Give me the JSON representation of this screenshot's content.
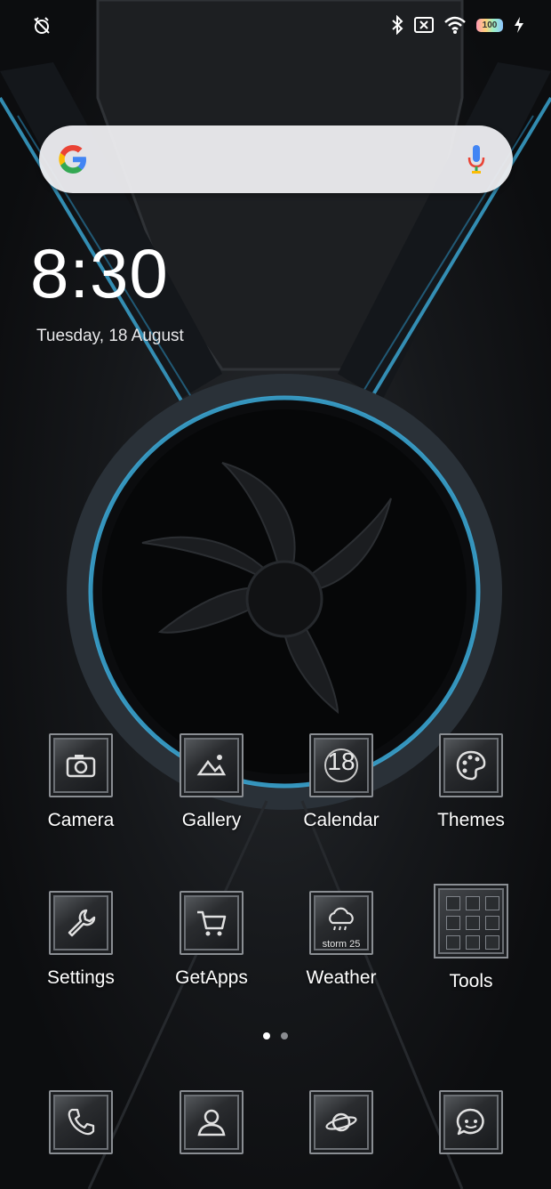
{
  "status_bar": {
    "left_icon": "alarm-off-icon",
    "right_icons": [
      "bluetooth-icon",
      "sim-off-icon",
      "wifi-icon",
      "battery-icon",
      "charging-icon"
    ],
    "battery_level": "100"
  },
  "search": {
    "logo": "G",
    "mic": "mic-icon"
  },
  "clock": {
    "time": "8:30",
    "date": "Tuesday, 18 August"
  },
  "apps_row1": [
    {
      "label": "Camera",
      "icon": "camera-icon"
    },
    {
      "label": "Gallery",
      "icon": "gallery-icon"
    },
    {
      "label": "Calendar",
      "icon": "calendar-icon",
      "icon_text": "18"
    },
    {
      "label": "Themes",
      "icon": "palette-icon"
    }
  ],
  "apps_row2": [
    {
      "label": "Settings",
      "icon": "wrench-icon"
    },
    {
      "label": "GetApps",
      "icon": "cart-icon"
    },
    {
      "label": "Weather",
      "icon": "cloud-rain-icon",
      "icon_text": "storm 25"
    },
    {
      "label": "Tools",
      "icon": "folder-grid-icon"
    }
  ],
  "pages": {
    "count": 2,
    "active": 1
  },
  "dock": [
    {
      "icon": "phone-icon"
    },
    {
      "icon": "contacts-icon"
    },
    {
      "icon": "browser-planet-icon"
    },
    {
      "icon": "messaging-icon"
    }
  ],
  "colors": {
    "accent": "#3fb7e8",
    "background": "#16181b"
  }
}
